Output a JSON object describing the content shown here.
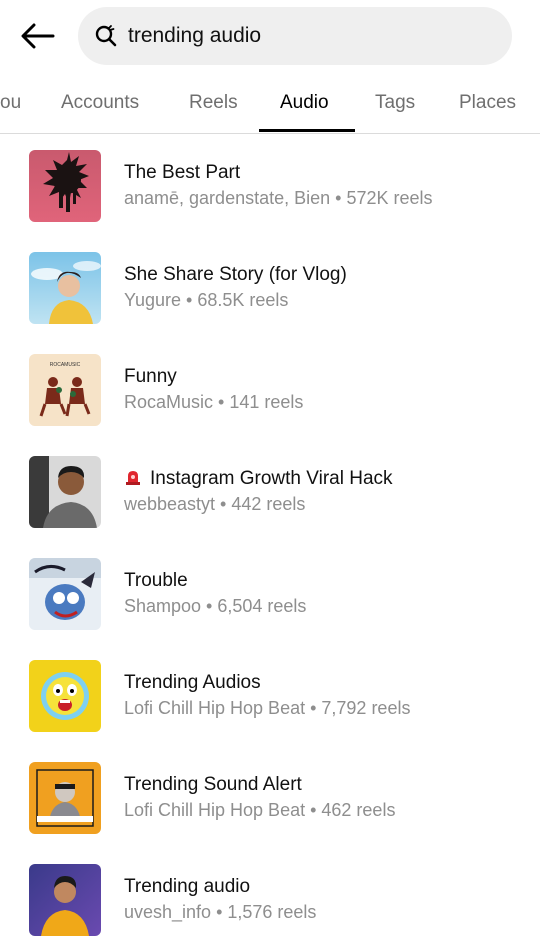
{
  "search": {
    "query": "trending audio"
  },
  "tabs": [
    {
      "label": "ou"
    },
    {
      "label": "Accounts"
    },
    {
      "label": "Reels"
    },
    {
      "label": "Audio"
    },
    {
      "label": "Tags"
    },
    {
      "label": "Places"
    }
  ],
  "active_tab": "Audio",
  "results": [
    {
      "title": "The Best Part",
      "subtitle": "anamē, gardenstate, Bien • 572K reels"
    },
    {
      "title": "She Share Story (for Vlog)",
      "subtitle": "Yugure • 68.5K reels"
    },
    {
      "title": "Funny",
      "subtitle": "RocaMusic • 141 reels",
      "thumb_text": "ROCAMUSIC"
    },
    {
      "title": "Instagram Growth Viral Hack",
      "subtitle": "webbeastyt • 442 reels",
      "title_icon": "alarm-light-icon"
    },
    {
      "title": "Trouble",
      "subtitle": "Shampoo • 6,504 reels"
    },
    {
      "title": "Trending Audios",
      "subtitle": "Lofi Chill Hip Hop Beat • 7,792 reels"
    },
    {
      "title": "Trending Sound Alert",
      "subtitle": "Lofi Chill Hip Hop Beat • 462 reels"
    },
    {
      "title": "Trending audio",
      "subtitle": "uvesh_info • 1,576 reels"
    }
  ],
  "colors": {
    "search_bg": "#efefef",
    "inactive_tab": "#6f6f6f",
    "subtitle": "#8e8e8e",
    "divider": "#dbdbdb"
  }
}
